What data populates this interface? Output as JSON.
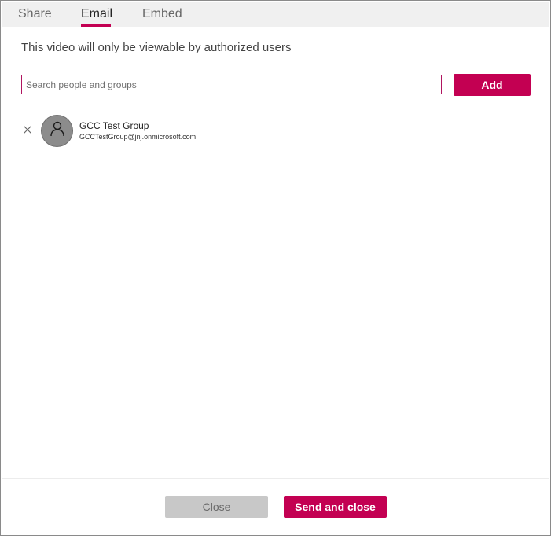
{
  "tabs": {
    "share": "Share",
    "email": "Email",
    "embed": "Embed",
    "active": "Email"
  },
  "notice": "This video will only be viewable by authorized users",
  "search": {
    "placeholder": "Search people and groups",
    "value": ""
  },
  "add_label": "Add",
  "recipients": [
    {
      "name": "GCC Test Group",
      "email": "GCCTestGroup@jnj.onmicrosoft.com",
      "avatar_icon": "person-icon",
      "remove_icon": "close-icon"
    }
  ],
  "footer": {
    "close_label": "Close",
    "send_label": "Send and close"
  },
  "colors": {
    "accent": "#c30052",
    "disabled_button": "#c8c8c8",
    "tab_bar": "#f0f0f0"
  }
}
